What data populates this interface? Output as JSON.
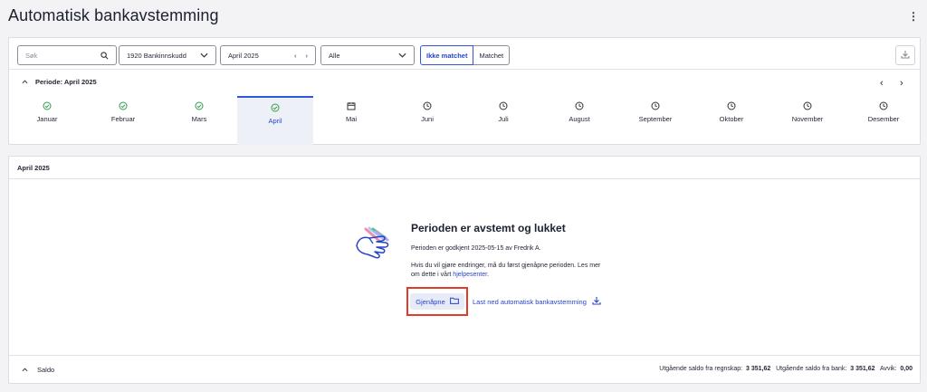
{
  "page": {
    "title": "Automatisk bankavstemming"
  },
  "filters": {
    "search_placeholder": "Søk",
    "account_value": "1920 Bankinnskudd",
    "period_value": "April 2025",
    "status_value": "Alle",
    "toggle_unmatched": "Ikke matchet",
    "toggle_matched": "Matchet"
  },
  "period": {
    "heading": "Periode: April 2025",
    "months": [
      {
        "label": "Januar",
        "icon": "check-circle-icon"
      },
      {
        "label": "Februar",
        "icon": "check-circle-icon"
      },
      {
        "label": "Mars",
        "icon": "check-circle-icon"
      },
      {
        "label": "April",
        "icon": "check-circle-icon"
      },
      {
        "label": "Mai",
        "icon": "calendar-icon"
      },
      {
        "label": "Juni",
        "icon": "clock-icon"
      },
      {
        "label": "Juli",
        "icon": "clock-icon"
      },
      {
        "label": "August",
        "icon": "clock-icon"
      },
      {
        "label": "September",
        "icon": "clock-icon"
      },
      {
        "label": "Oktober",
        "icon": "clock-icon"
      },
      {
        "label": "November",
        "icon": "clock-icon"
      },
      {
        "label": "Desember",
        "icon": "clock-icon"
      }
    ],
    "selected": "April"
  },
  "main": {
    "heading": "April 2025",
    "title": "Perioden er avstemt og lukket",
    "approved_text": "Perioden er godkjent 2025-05-15 av Fredrik A.",
    "info_text": "Hvis du vil gjøre endringer, må du først gjenåpne perioden. Les mer om dette i vårt ",
    "help_link": "hjelpesenter",
    "info_end": ".",
    "reopen_button": "Gjenåpne",
    "download_link": "Last ned automatisk bankavstemming"
  },
  "saldo": {
    "label": "Saldo",
    "ledger_label": "Utgående saldo fra regnskap:",
    "ledger_value": "3 351,62",
    "bank_label": "Utgående saldo fra bank:",
    "bank_value": "3 351,62",
    "deviation_label": "Avvik:",
    "deviation_value": "0,00"
  },
  "colors": {
    "accent": "#3355d8",
    "success": "#2e9e4f",
    "highlight": "#e23b2a"
  }
}
